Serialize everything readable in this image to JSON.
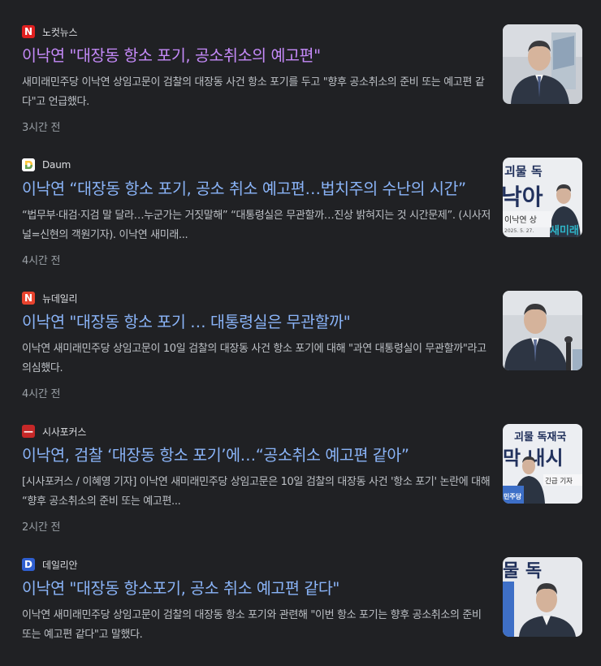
{
  "articles": [
    {
      "source": "노컷뉴스",
      "favicon_letter": "N",
      "favicon_color": "#e02020",
      "favicon_icon": "nocut-n-icon",
      "headline": "이낙연 \"대장동 항소 포기, 공소취소의 예고편\"",
      "visited": true,
      "snippet": "새미래민주당 이낙연 상임고문이 검찰의 대장동 사건 항소 포기를 두고 \"향후 공소취소의 준비 또는 예고편 같다\"고 언급했다.",
      "time": "3시간 전",
      "thumb_bg": "#c8ccd2"
    },
    {
      "source": "Daum",
      "favicon_letter": "D",
      "favicon_color": "#ffffff",
      "favicon_icon": "daum-icon",
      "headline": "이낙연 “대장동 항소 포기, 공소 취소 예고편…법치주의 수난의 시간”",
      "visited": false,
      "snippet": "“법무부·대검·지검 말 달라…누군가는 거짓말해” “대통령실은 무관할까…진상 밝혀지는 것 시간문제”. (시사저널=신현의 객원기자). 이낙연 새미래...",
      "time": "4시간 전",
      "thumb_text_top": "괴물 독",
      "thumb_text_mid": "낙아",
      "thumb_text_bot": "이낙연 상",
      "thumb_text_date": "2025. 5. 27.",
      "thumb_text_brand": "새미래",
      "thumb_bg": "#e8eaee"
    },
    {
      "source": "뉴데일리",
      "favicon_letter": "N",
      "favicon_color": "#e8432e",
      "favicon_icon": "newdaily-n-icon",
      "headline": "이낙연 \"대장동 항소 포기 … 대통령실은 무관할까\"",
      "visited": false,
      "snippet": "이낙연 새미래민주당 상임고문이 10일 검찰의 대장동 사건 항소 포기에 대해 \"과연 대통령실이 무관할까\"라고 의심했다.",
      "time": "4시간 전",
      "thumb_bg": "#cfd3d8"
    },
    {
      "source": "시사포커스",
      "favicon_letter": "—",
      "favicon_color": "#c62828",
      "favicon_icon": "sisafocus-icon",
      "headline": "이낙연, 검찰 ‘대장동 항소 포기’에…“공소취소 예고편 같아”",
      "visited": false,
      "snippet": "[시사포커스 / 이혜영 기자] 이낙연 새미래민주당 상임고문은 10일 검찰의 대장동 사건 '항소 포기' 논란에 대해 “향후 공소취소의 준비 또는 예고편...",
      "time": "2시간 전",
      "thumb_text_top": "괴물 독재국",
      "thumb_text_mid": "막 내시",
      "thumb_text_bot": "긴급 기자",
      "thumb_text_brand": "민주당",
      "thumb_bg": "#e9ebef"
    },
    {
      "source": "데일리안",
      "favicon_letter": "D",
      "favicon_color": "#2f5fd0",
      "favicon_icon": "dailian-d-icon",
      "headline": "이낙연 \"대장동 항소포기, 공소 취소 예고편 같다\"",
      "visited": false,
      "snippet": "이낙연 새미래민주당 상임고문이 검찰의 대장동 항소 포기와 관련해 \"이번 항소 포기는 향후 공소취소의 준비 또는 예고편 같다\"고 말했다.",
      "time": "",
      "thumb_text_top": "물 독",
      "thumb_bg": "#e4e6ea"
    }
  ]
}
